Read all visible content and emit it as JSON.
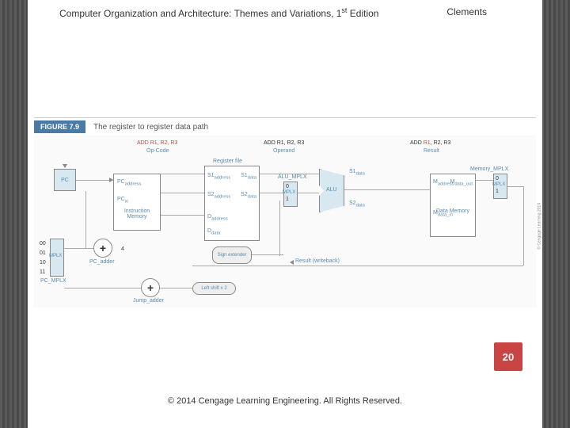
{
  "header": {
    "title_part1": "Computer Organization and Architecture: Themes and Variations, 1",
    "title_sup": "st",
    "title_part2": " Edition",
    "author": "Clements"
  },
  "figure": {
    "badge": "FIGURE 7.9",
    "caption": "The register to register data path"
  },
  "diagram": {
    "instruction": "ADD R1, R2, R3",
    "opcode_label": "Op-Code",
    "operand_label": "Operand",
    "result_label": "Result",
    "pc": "PC",
    "pc_address": "PC",
    "pc_address_sub": "address",
    "pc_in": "PC",
    "pc_in_sub": "in",
    "instruction_memory": "Instruction\nMemory",
    "register_file": "Register file",
    "s1_address": "S1",
    "s1_data": "S1",
    "s2_address": "S2",
    "s2_data": "S2",
    "d_address": "D",
    "d_data": "D",
    "sub_address": "address",
    "sub_data": "data",
    "alu": "ALU",
    "alu_mplx": "ALU_MPLX",
    "mplx": "MPLX",
    "mplx_in0": "0",
    "mplx_in1": "1",
    "memory_mplx": "Memory_MPLX",
    "m_address": "M",
    "m_data_out": "M",
    "m_data_in": "M",
    "sub_data_out": "data_out",
    "sub_data_in": "data_in",
    "data_memory": "Data\nMemory",
    "pc_adder": "PC_adder",
    "pc_mplx": "PC_MPLX",
    "pc_mplx_00": "00",
    "pc_mplx_01": "01",
    "pc_mplx_10": "10",
    "pc_mplx_11": "11",
    "adder_4": "4",
    "sign_extender": "Sign\nextender",
    "left_shift": "Left shift x 2",
    "jump_adder": "Jump_adder",
    "result_writeback": "Result (writeback)",
    "plus": "+",
    "copyright_side": "© Cengage Learning 2014"
  },
  "page_number": "20",
  "copyright": "© 2014 Cengage Learning Engineering. All Rights Reserved."
}
